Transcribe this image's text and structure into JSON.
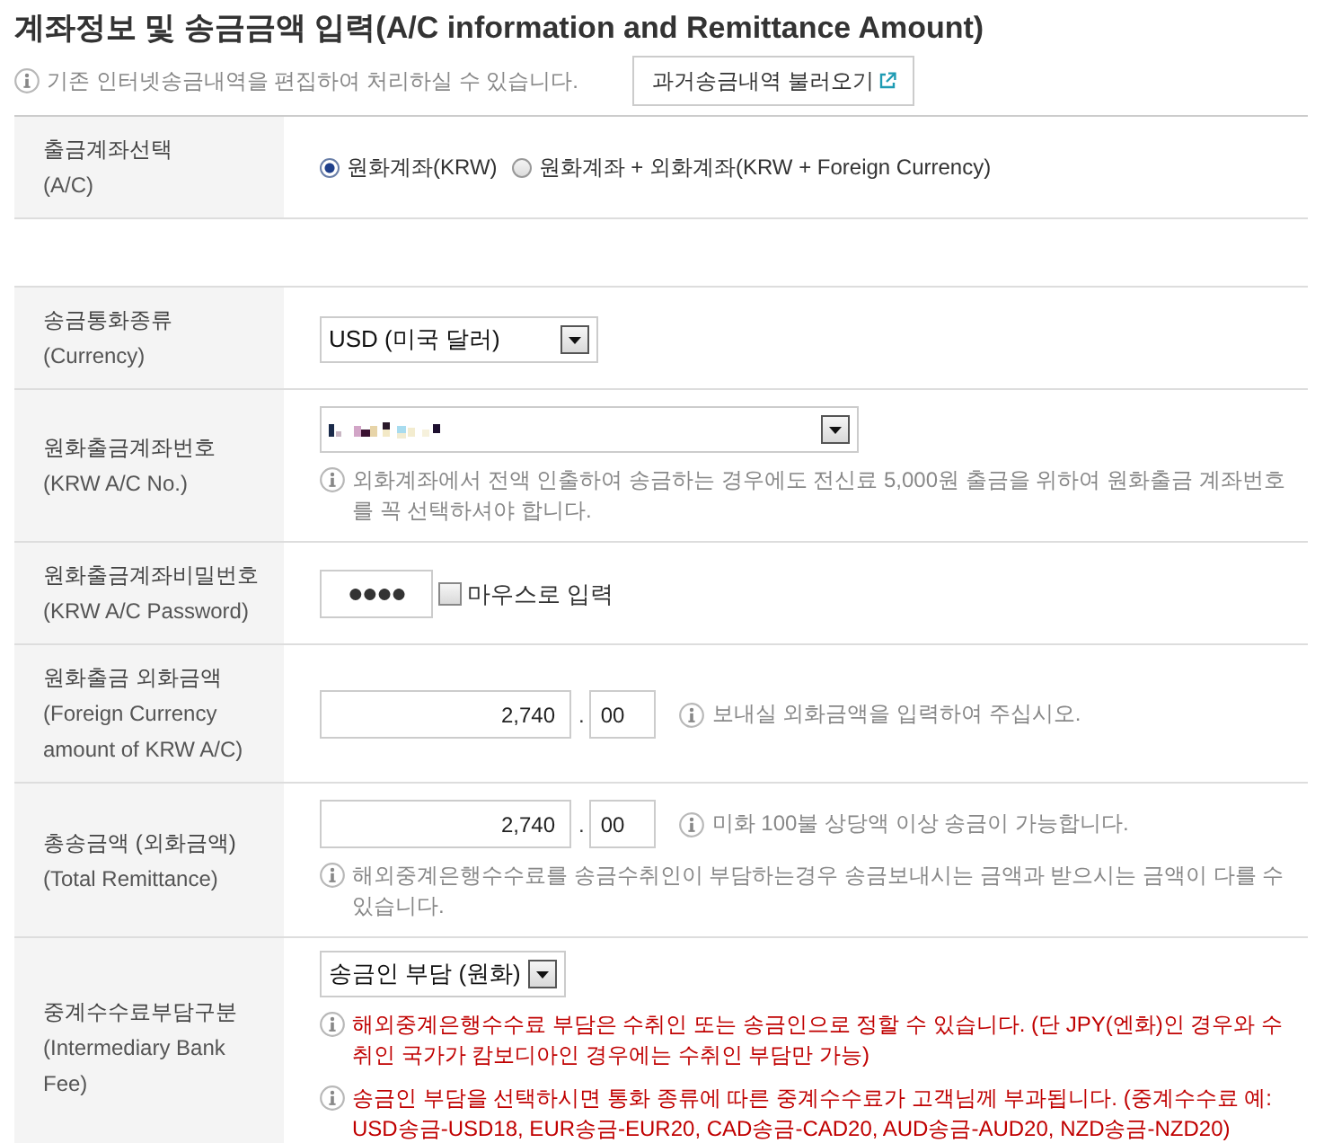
{
  "title": "계좌정보 및 송금금액 입력(A/C information and Remittance Amount)",
  "intro": {
    "note": {
      "kind": "info",
      "text": "기존 인터넷송금내역을 편집하여 처리하실 수 있습니다."
    },
    "button": "과거송금내역 불러오기"
  },
  "account_section": {
    "rows": [
      {
        "label_ko": "출금계좌선택",
        "label_en": "(A/C)",
        "kind": "radio_group",
        "options": [
          {
            "label": "원화계좌(KRW)",
            "selected": true
          },
          {
            "label": "원화계좌 + 외화계좌(KRW + Foreign Currency)",
            "selected": false
          }
        ]
      }
    ]
  },
  "remittance_section": {
    "rows": [
      {
        "label_ko": "송금통화종류",
        "label_en": "(Currency)",
        "kind": "select",
        "value": "USD (미국 달러)"
      },
      {
        "label_ko": "원화출금계좌번호",
        "label_en": "(KRW A/C No.)",
        "kind": "masked_select",
        "notes": [
          {
            "kind": "info",
            "text": "외화계좌에서 전액 인출하여 송금하는 경우에도 전신료 5,000원 출금을 위하여 원화출금 계좌번호를 꼭 선택하셔야 합니다."
          }
        ]
      },
      {
        "label_ko": "원화출금계좌비밀번호",
        "label_en": "(KRW A/C Password)",
        "kind": "password",
        "value": "●●●●",
        "checkbox": {
          "label": "마우스로 입력",
          "checked": false
        }
      },
      {
        "label_ko": "원화출금 외화금액",
        "label_en": "(Foreign Currency amount of KRW A/C)",
        "kind": "amount",
        "integer": "2,740",
        "separator": ".",
        "decimal": "00",
        "inline_note": {
          "kind": "info",
          "text": "보내실 외화금액을 입력하여 주십시오."
        }
      },
      {
        "label_ko": "총송금액 (외화금액)",
        "label_en": "(Total Remittance)",
        "kind": "amount",
        "integer": "2,740",
        "separator": ".",
        "decimal": "00",
        "inline_note": {
          "kind": "info",
          "text": "미화 100불 상당액 이상 송금이 가능합니다."
        },
        "notes": [
          {
            "kind": "info",
            "text": "해외중계은행수수료를 송금수취인이 부담하는경우 송금보내시는 금액과 받으시는 금액이 다를 수 있습니다."
          }
        ]
      },
      {
        "label_ko": "중계수수료부담구분",
        "label_en": "(Intermediary Bank Fee)",
        "kind": "select",
        "value": "송금인 부담 (원화)",
        "notes": [
          {
            "kind": "warning",
            "text": "해외중계은행수수료 부담은 수취인 또는 송금인으로 정할 수 있습니다. (단 JPY(엔화)인 경우와 수취인 국가가 캄보디아인 경우에는 수취인 부담만 가능)"
          },
          {
            "kind": "warning",
            "text": "송금인 부담을 선택하시면 통화 종류에 따른 중계수수료가 고객님께 부과됩니다. (중계수수료 예: USD송금-USD18, EUR송금-EUR20, CAD송금-CAD20, AUD송금-AUD20, NZD송금-NZD20)"
          }
        ]
      }
    ]
  }
}
